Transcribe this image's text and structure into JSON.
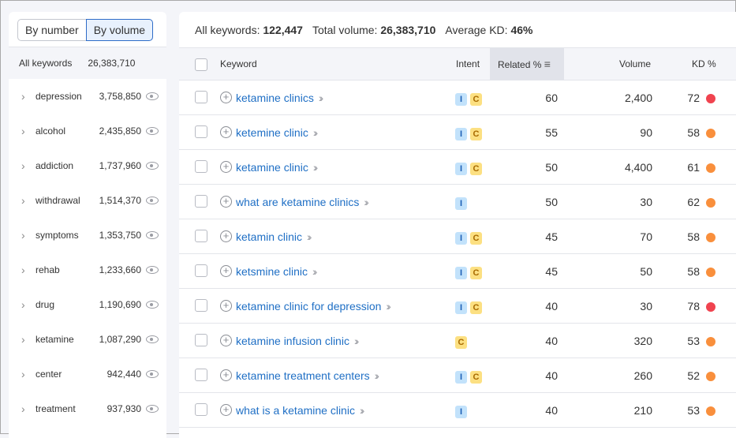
{
  "left": {
    "toggle": [
      "By number",
      "By volume"
    ],
    "all_label": "All keywords",
    "all_volume": "26,383,710",
    "groups": [
      [
        "depression",
        "3,758,850"
      ],
      [
        "alcohol",
        "2,435,850"
      ],
      [
        "addiction",
        "1,737,960"
      ],
      [
        "withdrawal",
        "1,514,370"
      ],
      [
        "symptoms",
        "1,353,750"
      ],
      [
        "rehab",
        "1,233,660"
      ],
      [
        "drug",
        "1,190,690"
      ],
      [
        "ketamine",
        "1,087,290"
      ],
      [
        "center",
        "942,440"
      ],
      [
        "treatment",
        "937,930"
      ]
    ]
  },
  "summary": {
    "all_label": "All keywords:",
    "all_value": "122,447",
    "total_label": "Total volume:",
    "total_value": "26,383,710",
    "kd_label": "Average KD:",
    "kd_value": "46%"
  },
  "columns": {
    "keyword": "Keyword",
    "intent": "Intent",
    "related": "Related %",
    "volume": "Volume",
    "kd": "KD %"
  },
  "colors": {
    "kd_red": "#f0434f",
    "kd_orange": "#f98f3c",
    "link": "#1f6fc5"
  },
  "rows": [
    {
      "keyword": "ketamine clinics",
      "intent": [
        "I",
        "C"
      ],
      "related": "60",
      "volume": "2,400",
      "kd": "72",
      "kd_color": "#f0434f"
    },
    {
      "keyword": "ketemine clinic",
      "intent": [
        "I",
        "C"
      ],
      "related": "55",
      "volume": "90",
      "kd": "58",
      "kd_color": "#f98f3c"
    },
    {
      "keyword": "ketamine clinic",
      "intent": [
        "I",
        "C"
      ],
      "related": "50",
      "volume": "4,400",
      "kd": "61",
      "kd_color": "#f98f3c"
    },
    {
      "keyword": "what are ketamine clinics",
      "intent": [
        "I"
      ],
      "related": "50",
      "volume": "30",
      "kd": "62",
      "kd_color": "#f98f3c"
    },
    {
      "keyword": "ketamin clinic",
      "intent": [
        "I",
        "C"
      ],
      "related": "45",
      "volume": "70",
      "kd": "58",
      "kd_color": "#f98f3c"
    },
    {
      "keyword": "ketsmine clinic",
      "intent": [
        "I",
        "C"
      ],
      "related": "45",
      "volume": "50",
      "kd": "58",
      "kd_color": "#f98f3c"
    },
    {
      "keyword": "ketamine clinic for depression",
      "intent": [
        "I",
        "C"
      ],
      "related": "40",
      "volume": "30",
      "kd": "78",
      "kd_color": "#f0434f"
    },
    {
      "keyword": "ketamine infusion clinic",
      "intent": [
        "C"
      ],
      "related": "40",
      "volume": "320",
      "kd": "53",
      "kd_color": "#f98f3c"
    },
    {
      "keyword": "ketamine treatment centers",
      "intent": [
        "I",
        "C"
      ],
      "related": "40",
      "volume": "260",
      "kd": "52",
      "kd_color": "#f98f3c"
    },
    {
      "keyword": "what is a ketamine clinic",
      "intent": [
        "I"
      ],
      "related": "40",
      "volume": "210",
      "kd": "53",
      "kd_color": "#f98f3c"
    }
  ]
}
